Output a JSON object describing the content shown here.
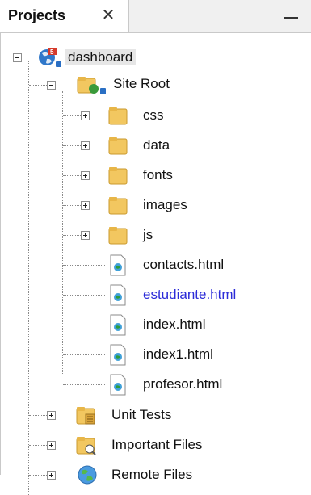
{
  "panel": {
    "tab_title": "Projects",
    "close_symbol": "✕"
  },
  "tree": {
    "project": {
      "label": "dashboard",
      "icon": "html5-project-icon"
    },
    "site_root": {
      "label": "Site Root",
      "icon": "site-root-folder-icon",
      "folders": [
        {
          "label": "css"
        },
        {
          "label": "data"
        },
        {
          "label": "fonts"
        },
        {
          "label": "images"
        },
        {
          "label": "js"
        }
      ],
      "files": [
        {
          "label": "contacts.html",
          "modified": false
        },
        {
          "label": "estudiante.html",
          "modified": true
        },
        {
          "label": "index.html",
          "modified": false
        },
        {
          "label": "index1.html",
          "modified": false
        },
        {
          "label": "profesor.html",
          "modified": false
        }
      ]
    },
    "other_nodes": [
      {
        "label": "Unit Tests",
        "icon": "unit-tests-folder-icon"
      },
      {
        "label": "Important Files",
        "icon": "important-files-folder-icon"
      },
      {
        "label": "Remote Files",
        "icon": "remote-files-globe-icon"
      }
    ]
  },
  "colors": {
    "modified_file": "#2b2bd8",
    "folder": "#f2c760",
    "toggle_border": "#8e8e8e"
  }
}
